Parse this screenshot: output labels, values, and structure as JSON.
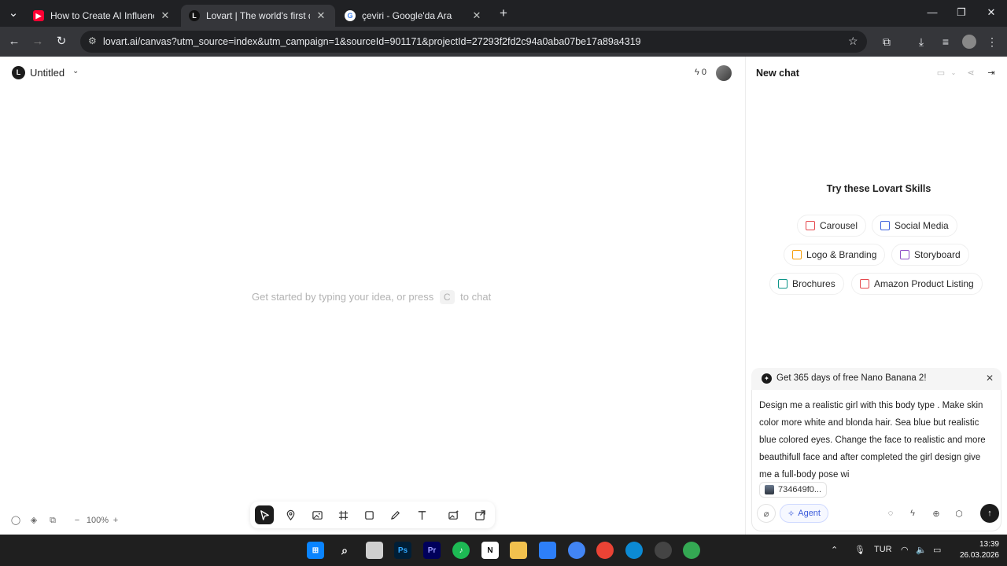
{
  "browser": {
    "tabs": [
      {
        "title": "How to Create AI Influencer For",
        "icon": "youtube-icon",
        "close": "✕"
      },
      {
        "title": "Lovart | The world's first design",
        "icon": "lovart-icon",
        "close": "✕"
      },
      {
        "title": "çeviri - Google'da Ara",
        "icon": "google-icon",
        "close": "✕"
      }
    ],
    "new_tab": "+",
    "url": "lovart.ai/canvas?utm_source=index&utm_campaign=1&sourceId=901171&projectId=27293f2fd2c94a0aba07be17a89a4319"
  },
  "app": {
    "project_title": "Untitled",
    "credits": "0",
    "canvas_hint": {
      "before": "Get started by typing your idea, or press",
      "key": "C",
      "after": "to chat"
    },
    "zoom": "100%",
    "zoom_minus": "−",
    "zoom_plus": "+"
  },
  "panel": {
    "title": "New chat",
    "skills_heading": "Try these Lovart Skills",
    "skills": [
      {
        "label": "Carousel",
        "color": "#e5484d"
      },
      {
        "label": "Social Media",
        "color": "#3e63dd"
      },
      {
        "label": "Logo & Branding",
        "color": "#f59e0b"
      },
      {
        "label": "Storyboard",
        "color": "#8e4ec6"
      },
      {
        "label": "Brochures",
        "color": "#0d9488"
      },
      {
        "label": "Amazon Product Listing",
        "color": "#e5484d"
      }
    ],
    "promo": "Get 365 days of free Nano Banana 2!",
    "prompt": "Design me a realistic girl with this body type . Make skin color more white and blonda hair. Sea blue but realistic blue colored eyes. Change the face to realistic and more beauthifull face and after completed the girl design give me a full-body pose wi",
    "attachment": "734649f0...",
    "agent_label": "Agent",
    "accent": "#3b5bdb"
  },
  "taskbar": {
    "language": "TUR",
    "time": "13:39",
    "date": "26.03.2026"
  }
}
